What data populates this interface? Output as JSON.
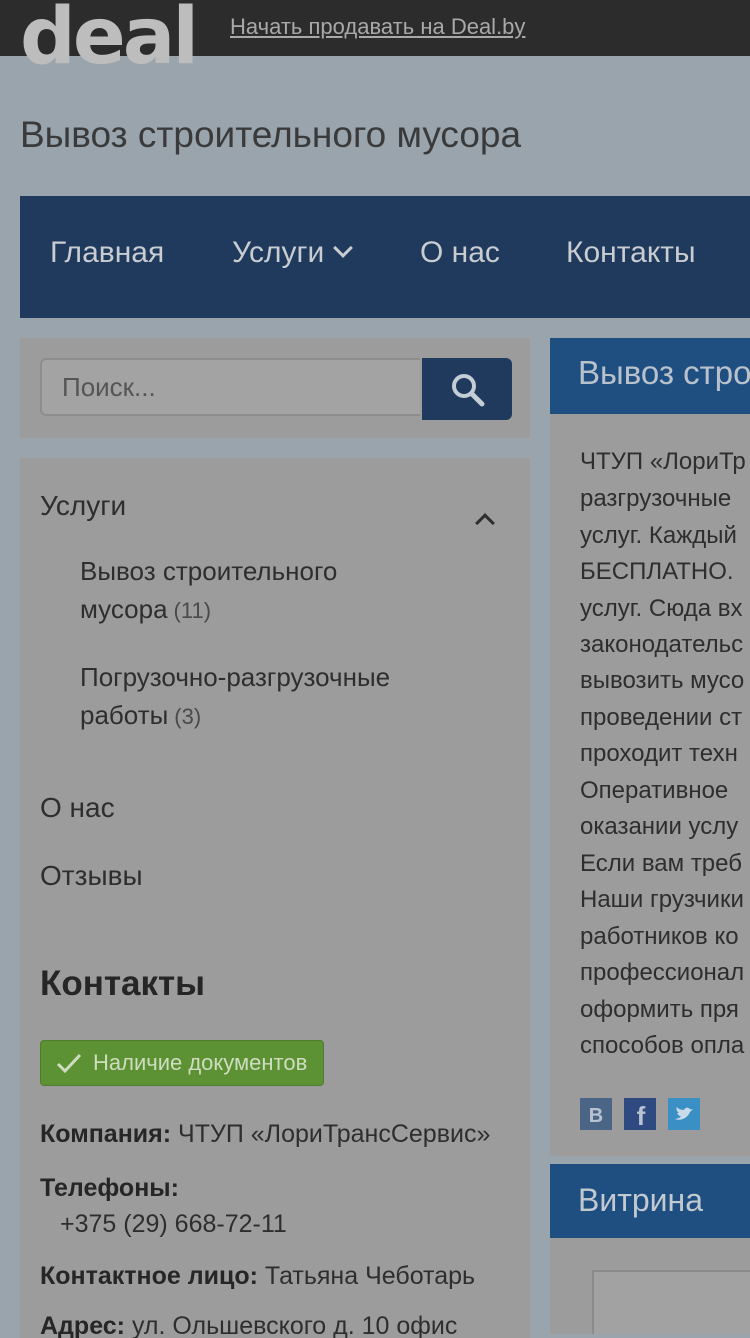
{
  "topbar": {
    "logo": "deal",
    "sell_link": "Начать продавать на Deal.by"
  },
  "site_title": "Вывоз строительного мусора",
  "nav": {
    "items": [
      {
        "label": "Главная"
      },
      {
        "label": "Услуги"
      },
      {
        "label": "О нас"
      },
      {
        "label": "Контакты"
      }
    ]
  },
  "search": {
    "placeholder": "Поиск..."
  },
  "sidebar": {
    "services_heading": "Услуги",
    "services": [
      {
        "line1": "Вывоз строительного",
        "line2": "мусора",
        "count": "(11)"
      },
      {
        "line1": "Погрузочно-разгрузочные",
        "line2": "работы",
        "count": "(3)"
      }
    ],
    "about": "О нас",
    "reviews": "Отзывы"
  },
  "contacts": {
    "title": "Контакты",
    "docs_badge": "Наличие документов",
    "company_label": "Компания:",
    "company_value": "ЧТУП «ЛориТрансСервис»",
    "phones_label": "Телефоны:",
    "phone": "+375 (29) 668-72-11",
    "person_label": "Контактное лицо:",
    "person_value": "Татьяна Чеботарь",
    "address_label": "Адрес:",
    "address_value": "ул. Ольшевского д. 10 офис"
  },
  "main": {
    "header": "Вывоз стро",
    "lines": [
      "ЧТУП «ЛориТр",
      "разгрузочные",
      "услуг. Каждый",
      "БЕСПЛАТНО.",
      "услуг. Сюда вх",
      "законодательс",
      "вывозить мусо",
      "проведении ст",
      "проходит техн",
      "Оперативное",
      "оказании услу",
      "Если вам треб",
      "Наши грузчики",
      "работников ко",
      "профессионал",
      "оформить пря",
      "способов опла"
    ],
    "social": [
      {
        "icon": "vkontakte-icon",
        "glyph": "B",
        "color": "#4a6585"
      },
      {
        "icon": "facebook-icon",
        "glyph": "f",
        "color": "#2f4a80"
      },
      {
        "icon": "twitter-icon",
        "glyph": "t",
        "color": "#3a8fc4"
      }
    ]
  },
  "vitrina": {
    "header": "Витрина"
  }
}
